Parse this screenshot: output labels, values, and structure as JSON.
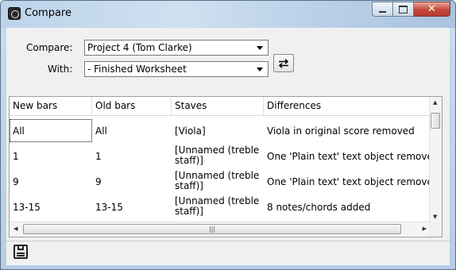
{
  "window": {
    "title": "Compare"
  },
  "compare": {
    "compare_label": "Compare:",
    "compare_value": "Project 4 (Tom Clarke)",
    "with_label": "With:",
    "with_value": "- Finished Worksheet"
  },
  "table": {
    "columns": [
      "New bars",
      "Old bars",
      "Staves",
      "Differences"
    ],
    "rows": [
      {
        "new": "All",
        "old": "All",
        "staves": "[Viola]",
        "diff": "Viola in original score removed"
      },
      {
        "new": "1",
        "old": "1",
        "staves": "[Unnamed (treble staff)]",
        "diff": "One 'Plain text' text object removed"
      },
      {
        "new": "9",
        "old": "9",
        "staves": "[Unnamed (treble staff)]",
        "diff": "One 'Plain text' text object removed"
      },
      {
        "new": "13-15",
        "old": "13-15",
        "staves": "[Unnamed (treble staff)]",
        "diff": "8 notes/chords added"
      }
    ]
  },
  "icons": {
    "app": "app-icon",
    "swap": "swap-arrows-icon",
    "save": "save-icon"
  }
}
